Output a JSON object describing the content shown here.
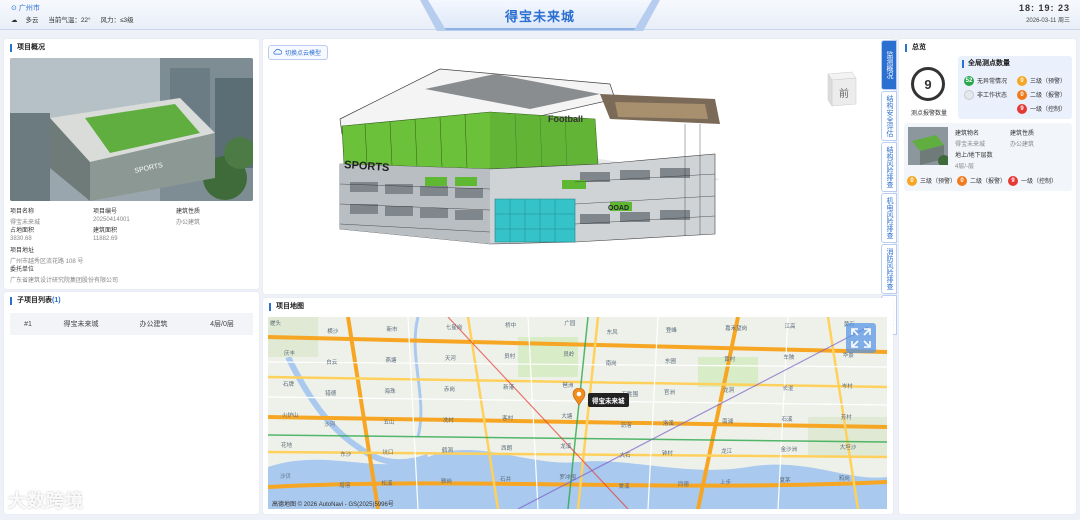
{
  "header": {
    "city": "广州市",
    "weather": {
      "condition": "多云",
      "temperature": "当前气温：22°",
      "wind": "风力：≤3级"
    },
    "title": "得宝未来城",
    "time": "18: 19: 23",
    "date": "2026-03-11 周三"
  },
  "overview": {
    "title": "项目概况",
    "fields": [
      {
        "label": "项目名称",
        "value": "得宝未来城"
      },
      {
        "label": "项目编号",
        "value": "20250414001"
      },
      {
        "label": "建筑性质",
        "value": "办公建筑"
      },
      {
        "label": "占地面积",
        "value": "3830.68"
      },
      {
        "label": "建筑面积",
        "value": "11882.69"
      },
      {
        "label": "项目地址",
        "value": "广州市越秀区流花路 108 号"
      },
      {
        "label": "委托单位",
        "value": "广东省建筑设计研究院集团股份有限公司"
      }
    ]
  },
  "subprojects": {
    "title": "子项目列表",
    "count": "(1)",
    "rows": [
      {
        "index": "#1",
        "name": "得宝未来城",
        "type": "办公建筑",
        "floors": "4层/0层"
      }
    ]
  },
  "model": {
    "switch_label": "切换点云模型",
    "view_cube_label": "前",
    "building_sign_top": "Football",
    "building_sign_left": "SPORTS",
    "building_sign_right": "OOAD"
  },
  "side_tabs": [
    {
      "label": "监测概况",
      "active": true
    },
    {
      "label": "结构安全评估",
      "active": false
    },
    {
      "label": "结构风险排查",
      "active": false
    },
    {
      "label": "机电风险排查",
      "active": false
    },
    {
      "label": "消防风险排查",
      "active": false
    },
    {
      "label": "房屋体检",
      "active": false
    }
  ],
  "summary": {
    "title": "总览",
    "alarm_count": "9",
    "alarm_label": "测点报警数量",
    "points_title": "全局测点数量",
    "points": [
      {
        "count": "52",
        "label": "无异常情况",
        "color": "#2aa84a"
      },
      {
        "count": "0",
        "label": "三级（预警）",
        "color": "#f5a623"
      },
      {
        "count": "0",
        "label": "非工作状态",
        "color": "#d0d4da"
      },
      {
        "count": "0",
        "label": "二级（报警）",
        "color": "#f07a1c"
      },
      {
        "count": "9",
        "label": "一级（控制）",
        "color": "#e53935"
      }
    ],
    "building": {
      "name_label": "建筑物名",
      "name_value": "得宝未来城",
      "type_label": "建筑性质",
      "type_value": "办公建筑",
      "floors_label": "地上/地下层数",
      "floors_value": "4层/-层",
      "levels": [
        {
          "count": "0",
          "label": "三级（预警）",
          "color": "#f5a623"
        },
        {
          "count": "0",
          "label": "二级（报警）",
          "color": "#f07a1c"
        },
        {
          "count": "9",
          "label": "一级（控制）",
          "color": "#e53935"
        }
      ]
    }
  },
  "map": {
    "title": "项目地图",
    "pin_label": "得宝未来城",
    "credit": "高德地图 © 2026 AutoNavi - GS(2025)5996号",
    "places": [
      "槎头",
      "横沙",
      "新市",
      "七星岗",
      "桥中",
      "广园",
      "东风",
      "登峰",
      "嘉禾望岗",
      "江高",
      "黄石",
      "庆丰",
      "白云",
      "燕塘",
      "天河",
      "员村",
      "员岭",
      "南岗",
      "东圃",
      "黄村",
      "车陂",
      "华景",
      "石牌",
      "猎德",
      "海珠",
      "赤岗",
      "新港",
      "琶洲",
      "万胜围",
      "官洲",
      "龙洞",
      "长湴",
      "岑村",
      "火炉山",
      "沙河",
      "五山",
      "冼村",
      "客村",
      "大塘",
      "沥滘",
      "洛溪",
      "南浦",
      "石溪",
      "芳村",
      "花地",
      "东沙",
      "坑口",
      "鹤洞",
      "西朗",
      "龙溪",
      "大石",
      "钟村",
      "龙江",
      "金沙洲",
      "大坦沙",
      "沙贝",
      "增滘",
      "松溪",
      "雅岗",
      "石井",
      "罗冲围",
      "棠溪",
      "同德",
      "上步",
      "夏茅",
      "鸦岗"
    ]
  },
  "watermark": "大数跨境"
}
